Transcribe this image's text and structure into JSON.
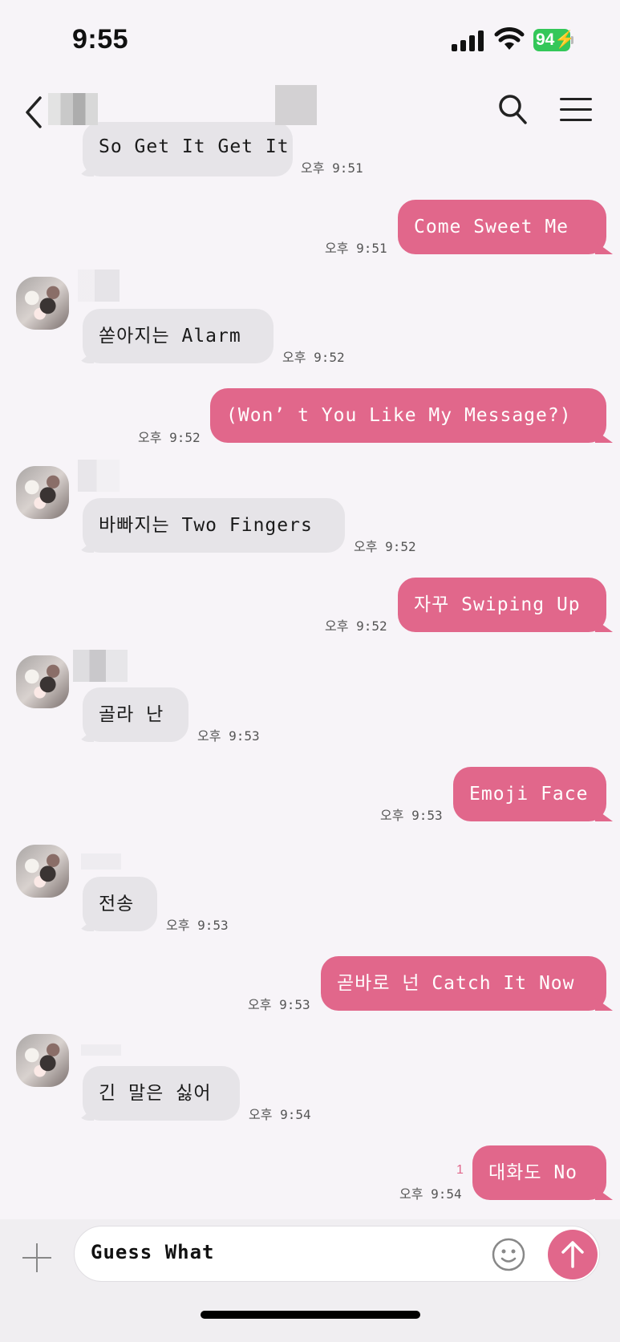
{
  "status": {
    "time": "9:55",
    "battery": "94"
  },
  "header": {
    "back_label": "back"
  },
  "messages": [
    {
      "dir": "in",
      "text": "So Get It Get It",
      "time": "오후 9:51"
    },
    {
      "dir": "out",
      "text": "Come Sweet Me",
      "time": "오후 9:51"
    },
    {
      "dir": "in",
      "text": "쏟아지는 Alarm",
      "time": "오후 9:52"
    },
    {
      "dir": "out",
      "text": "(Won’ t You Like My Message?)",
      "time": "오후 9:52"
    },
    {
      "dir": "in",
      "text": "바빠지는 Two Fingers",
      "time": "오후 9:52"
    },
    {
      "dir": "out",
      "text": "자꾸 Swiping Up",
      "time": "오후 9:52"
    },
    {
      "dir": "in",
      "text": "골라 난",
      "time": "오후 9:53"
    },
    {
      "dir": "out",
      "text": "Emoji Face",
      "time": "오후 9:53"
    },
    {
      "dir": "in",
      "text": "전송",
      "time": "오후 9:53"
    },
    {
      "dir": "out",
      "text": "곧바로 넌 Catch It Now",
      "time": "오후 9:53"
    },
    {
      "dir": "in",
      "text": "긴 말은 싫어",
      "time": "오후 9:54"
    },
    {
      "dir": "out",
      "text": "대화도 No",
      "time": "오후 9:54",
      "unread": "1"
    }
  ],
  "input": {
    "value": "Guess What"
  },
  "colors": {
    "accent": "#e1678b",
    "incoming": "#e6e4e8",
    "background": "#f7f4f8"
  }
}
